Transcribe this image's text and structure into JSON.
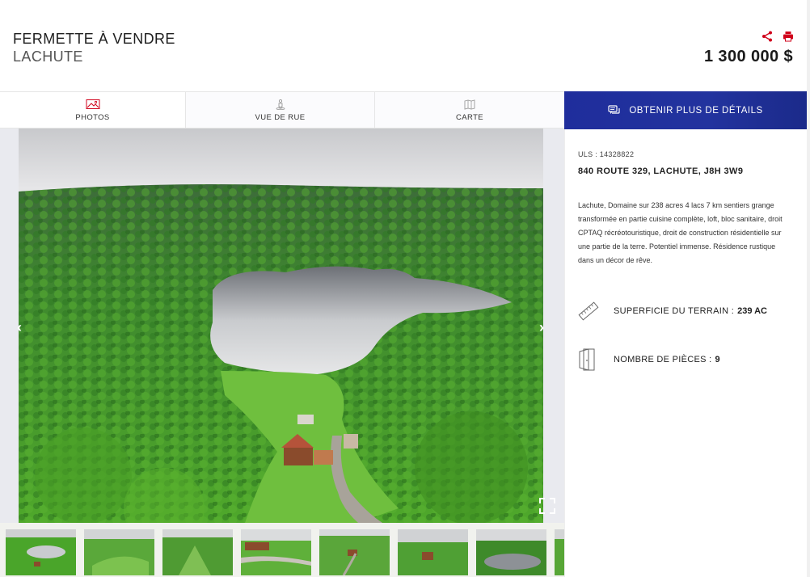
{
  "header": {
    "title": "FERMETTE À VENDRE",
    "subtitle": "LACHUTE",
    "price": "1 300 000 $",
    "share_icon": "share-icon",
    "print_icon": "print-icon",
    "accent_color": "#d0021b"
  },
  "tabs": [
    {
      "label": "PHOTOS",
      "icon": "image-icon",
      "active": true
    },
    {
      "label": "VUE DE RUE",
      "icon": "street-view-icon",
      "active": false
    },
    {
      "label": "CARTE",
      "icon": "map-icon",
      "active": false
    }
  ],
  "cta": {
    "label": "OBTENIR PLUS DE DÉTAILS",
    "icon": "chat-icon",
    "color": "#1f2d9c"
  },
  "gallery": {
    "prev_icon": "chevron-left-icon",
    "next_icon": "chevron-right-icon",
    "fullscreen_icon": "fullscreen-icon",
    "prev_glyph": "‹",
    "next_glyph": "›"
  },
  "details": {
    "uls": "ULS : 14328822",
    "address": "840 ROUTE 329, LACHUTE, J8H 3W9",
    "description": "Lachute, Domaine sur 238 acres 4 lacs 7 km sentiers grange transformée en partie cuisine complète, loft, bloc sanitaire, droit CPTAQ récréotouristique, droit de construction résidentielle sur une partie de la terre. Potentiel immense. Résidence rustique dans un décor de rêve.",
    "features": [
      {
        "label": "SUPERFICIE DU TERRAIN :",
        "value": "239 AC",
        "icon": "ruler-icon"
      },
      {
        "label": "NOMBRE DE PIÈCES :",
        "value": "9",
        "icon": "door-icon"
      }
    ]
  }
}
